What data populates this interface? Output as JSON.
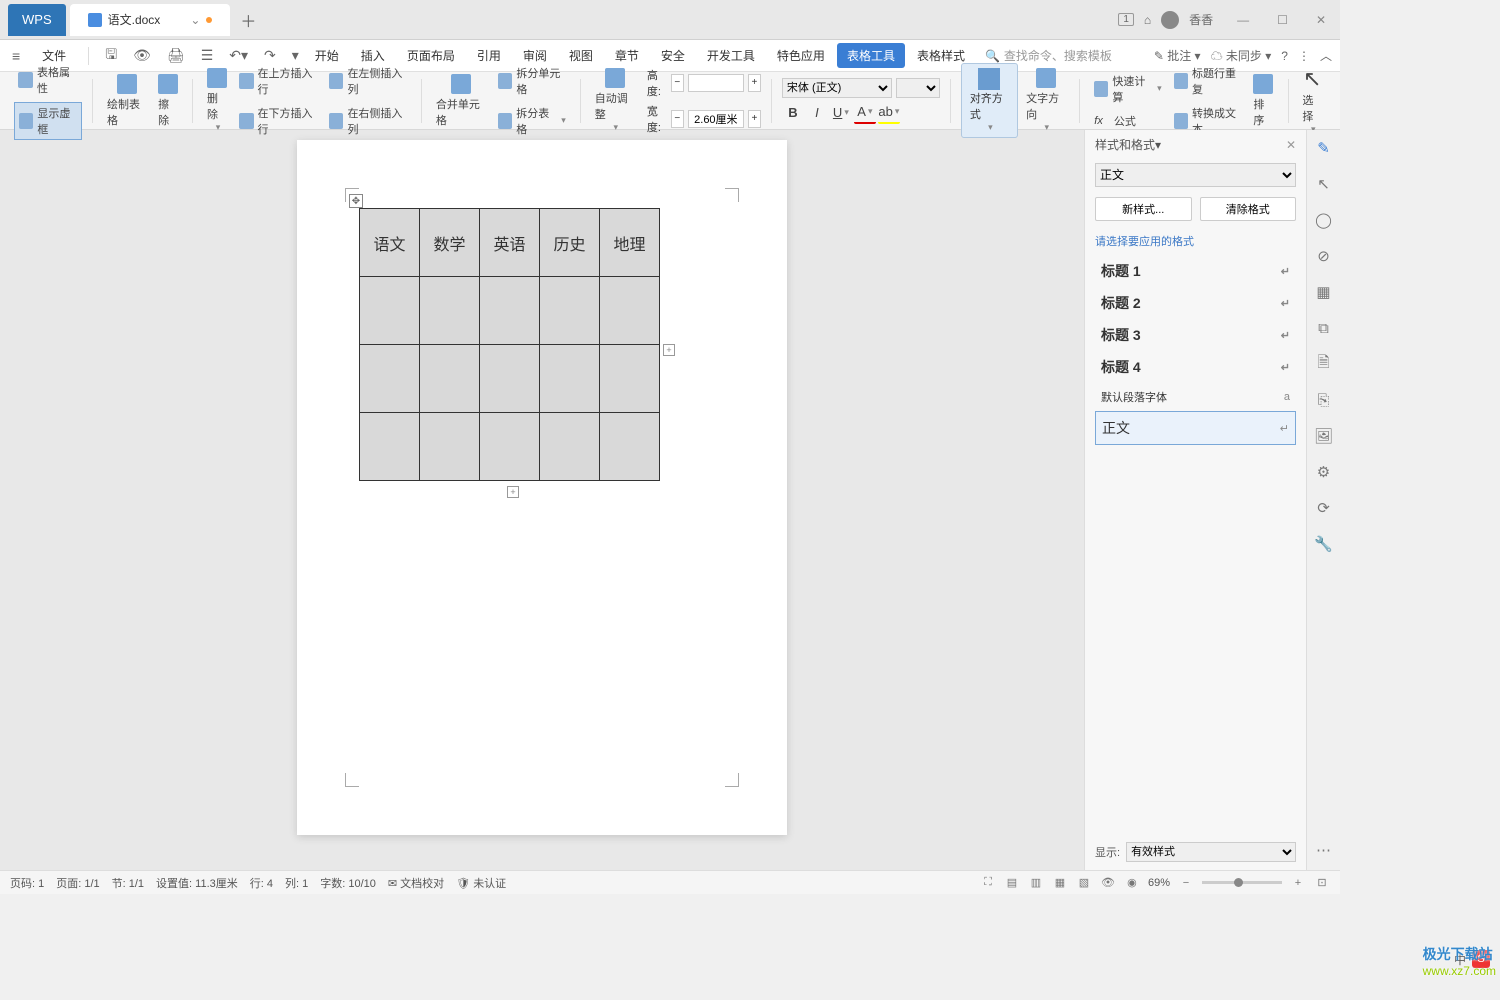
{
  "titlebar": {
    "app": "WPS",
    "doc_title": "语文.docx",
    "badge": "1",
    "user": "香香"
  },
  "menu": {
    "file": "文件",
    "items": [
      "开始",
      "插入",
      "页面布局",
      "引用",
      "审阅",
      "视图",
      "章节",
      "安全",
      "开发工具",
      "特色应用",
      "表格工具",
      "表格样式"
    ],
    "active_idx": 10,
    "search_placeholder": "查找命令、搜索模板",
    "right": {
      "comment": "批注",
      "sync": "未同步"
    }
  },
  "ribbon": {
    "table_props": "表格属性",
    "show_gridlines": "显示虚框",
    "draw_table": "绘制表格",
    "eraser": "擦除",
    "delete": "删除",
    "insert_above": "在上方插入行",
    "insert_below": "在下方插入行",
    "insert_left": "在左侧插入列",
    "insert_right": "在右侧插入列",
    "merge": "合并单元格",
    "split_cell": "拆分单元格",
    "split_table": "拆分表格",
    "autofit": "自动调整",
    "height_label": "高度:",
    "height_val": "",
    "width_label": "宽度:",
    "width_val": "2.60厘米",
    "font_name": "宋体 (正文)",
    "font_size": "",
    "align": "对齐方式",
    "text_dir": "文字方向",
    "formula_icon": "fx",
    "formula": "公式",
    "fast_calc": "快速计算",
    "header_repeat": "标题行重复",
    "to_text": "转换成文本",
    "sort": "排序",
    "select": "选择"
  },
  "table": {
    "headers": [
      "语文",
      "数学",
      "英语",
      "历史",
      "地理"
    ],
    "rows": 4,
    "cols": 5
  },
  "sidepanel": {
    "title": "样式和格式",
    "current": "正文",
    "new_style": "新样式...",
    "clear": "清除格式",
    "prompt": "请选择要应用的格式",
    "styles": [
      {
        "name": "标题 1",
        "type": "heading"
      },
      {
        "name": "标题 2",
        "type": "heading"
      },
      {
        "name": "标题 3",
        "type": "heading"
      },
      {
        "name": "标题 4",
        "type": "heading"
      },
      {
        "name": "默认段落字体",
        "type": "small"
      },
      {
        "name": "正文",
        "type": "body",
        "selected": true
      }
    ],
    "show_label": "显示:",
    "show_value": "有效样式"
  },
  "status": {
    "page_no": "页码: 1",
    "page": "页面: 1/1",
    "section": "节: 1/1",
    "pos": "设置值: 11.3厘米",
    "line": "行: 4",
    "col": "列: 1",
    "words": "字数: 10/10",
    "proof": "文档校对",
    "cert": "未认证",
    "zoom": "69%"
  },
  "watermark": {
    "line1": "极光下载站",
    "line2": "www.xz7.com"
  },
  "ime": "中"
}
